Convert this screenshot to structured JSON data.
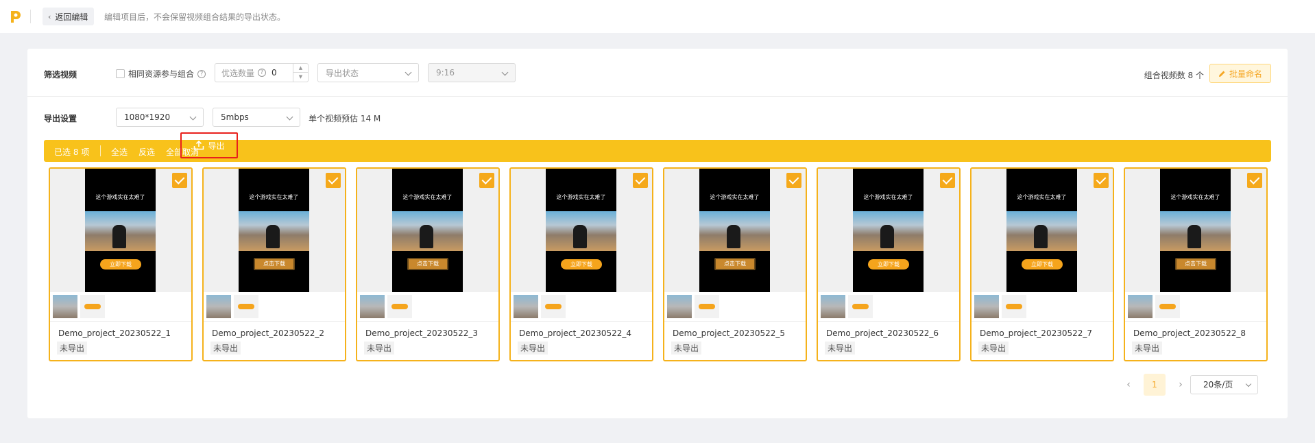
{
  "topbar": {
    "back_label": "返回编辑",
    "hint": "编辑项目后，不会保留视频组合结果的导出状态。"
  },
  "filter": {
    "label": "筛选视频",
    "same_resource_label": "相同资源参与组合",
    "priority_placeholder": "优选数量",
    "priority_value": "0",
    "export_status_placeholder": "导出状态",
    "ratio_value": "9:16",
    "combo_count": "组合视频数 8 个",
    "rename_label": "批量命名"
  },
  "export_settings": {
    "label": "导出设置",
    "resolution": "1080*1920",
    "bitrate": "5mbps",
    "estimate": "单个视频预估 14 M"
  },
  "toolbar": {
    "selected": "已选 8 项",
    "select_all": "全选",
    "invert": "反选",
    "deselect_all": "全部取消",
    "export": "导出"
  },
  "cards": [
    {
      "name": "Demo_project_20230522_1",
      "status": "未导出",
      "caption": "这个游戏实在太难了",
      "btn": "立即下载"
    },
    {
      "name": "Demo_project_20230522_2",
      "status": "未导出",
      "caption": "这个游戏实在太难了",
      "btn": "点击下载"
    },
    {
      "name": "Demo_project_20230522_3",
      "status": "未导出",
      "caption": "这个游戏实在太难了",
      "btn": "点击下载"
    },
    {
      "name": "Demo_project_20230522_4",
      "status": "未导出",
      "caption": "这个游戏实在太难了",
      "btn": "立即下载"
    },
    {
      "name": "Demo_project_20230522_5",
      "status": "未导出",
      "caption": "这个游戏实在太难了",
      "btn": "点击下载"
    },
    {
      "name": "Demo_project_20230522_6",
      "status": "未导出",
      "caption": "这个游戏实在太难了",
      "btn": "立即下载"
    },
    {
      "name": "Demo_project_20230522_7",
      "status": "未导出",
      "caption": "这个游戏实在太难了",
      "btn": "立即下载"
    },
    {
      "name": "Demo_project_20230522_8",
      "status": "未导出",
      "caption": "这个游戏实在太难了",
      "btn": "点击下载"
    }
  ],
  "pagination": {
    "prev": "‹",
    "current": "1",
    "next": "›",
    "page_size": "20条/页"
  },
  "colors": {
    "accent": "#f8c21b",
    "card_border": "#f5b21b",
    "highlight_box": "#e8201c"
  }
}
